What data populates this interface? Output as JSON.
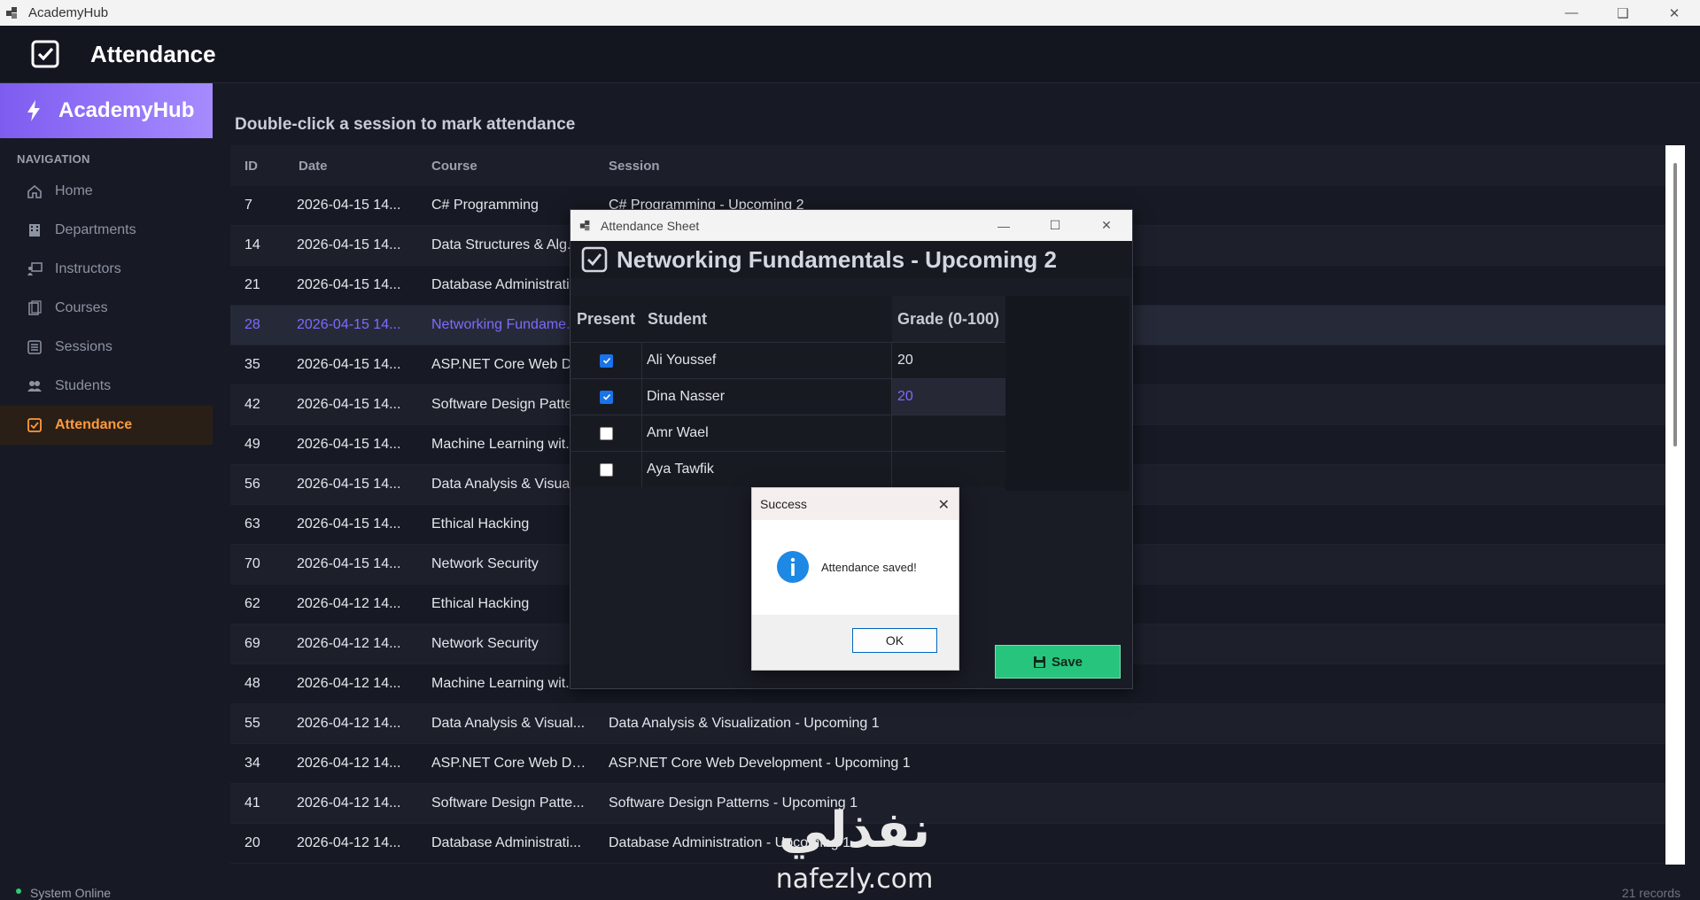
{
  "window": {
    "title": "AcademyHub"
  },
  "header": {
    "title": "Attendance"
  },
  "sidebar": {
    "brand": "AcademyHub",
    "nav_label": "NAVIGATION",
    "items": [
      {
        "label": "Home",
        "icon": "home-icon"
      },
      {
        "label": "Departments",
        "icon": "building-icon"
      },
      {
        "label": "Instructors",
        "icon": "person-board-icon"
      },
      {
        "label": "Courses",
        "icon": "book-icon"
      },
      {
        "label": "Sessions",
        "icon": "list-icon"
      },
      {
        "label": "Students",
        "icon": "users-icon"
      },
      {
        "label": "Attendance",
        "icon": "checkbox-icon",
        "active": true
      }
    ]
  },
  "main": {
    "instruction": "Double-click a session to mark attendance",
    "columns": {
      "id": "ID",
      "date": "Date",
      "course": "Course",
      "session": "Session"
    },
    "rows": [
      {
        "id": "7",
        "date": "2026-04-15 14...",
        "course": "C# Programming",
        "session": "C# Programming - Upcoming 2"
      },
      {
        "id": "14",
        "date": "2026-04-15 14...",
        "course": "Data Structures & Alg...",
        "session": ""
      },
      {
        "id": "21",
        "date": "2026-04-15 14...",
        "course": "Database Administrati...",
        "session": ""
      },
      {
        "id": "28",
        "date": "2026-04-15 14...",
        "course": "Networking Fundame...",
        "session": ""
      },
      {
        "id": "35",
        "date": "2026-04-15 14...",
        "course": "ASP.NET Core Web De...",
        "session": ""
      },
      {
        "id": "42",
        "date": "2026-04-15 14...",
        "course": "Software Design Patte...",
        "session": ""
      },
      {
        "id": "49",
        "date": "2026-04-15 14...",
        "course": "Machine Learning wit...",
        "session": ""
      },
      {
        "id": "56",
        "date": "2026-04-15 14...",
        "course": "Data Analysis & Visual...",
        "session": ""
      },
      {
        "id": "63",
        "date": "2026-04-15 14...",
        "course": "Ethical Hacking",
        "session": ""
      },
      {
        "id": "70",
        "date": "2026-04-15 14...",
        "course": "Network Security",
        "session": ""
      },
      {
        "id": "62",
        "date": "2026-04-12 14...",
        "course": "Ethical Hacking",
        "session": ""
      },
      {
        "id": "69",
        "date": "2026-04-12 14...",
        "course": "Network Security",
        "session": ""
      },
      {
        "id": "48",
        "date": "2026-04-12 14...",
        "course": "Machine Learning wit...",
        "session": ""
      },
      {
        "id": "55",
        "date": "2026-04-12 14...",
        "course": "Data Analysis & Visual...",
        "session": "Data Analysis & Visualization - Upcoming 1"
      },
      {
        "id": "34",
        "date": "2026-04-12 14...",
        "course": "ASP.NET Core Web De...",
        "session": "ASP.NET Core Web Development - Upcoming 1"
      },
      {
        "id": "41",
        "date": "2026-04-12 14...",
        "course": "Software Design Patte...",
        "session": "Software Design Patterns - Upcoming 1"
      },
      {
        "id": "20",
        "date": "2026-04-12 14...",
        "course": "Database Administrati...",
        "session": "Database Administration - Upcoming 1"
      }
    ],
    "selected_row_id": "28"
  },
  "status": {
    "online": "System Online",
    "records": "21 records"
  },
  "sheet": {
    "window_title": "Attendance Sheet",
    "title": "Networking Fundamentals - Upcoming 2",
    "columns": {
      "present": "Present",
      "student": "Student",
      "grade": "Grade (0-100)"
    },
    "students": [
      {
        "present": true,
        "name": "Ali Youssef",
        "grade": "20"
      },
      {
        "present": true,
        "name": "Dina Nasser",
        "grade": "20"
      },
      {
        "present": false,
        "name": "Amr Wael",
        "grade": ""
      },
      {
        "present": false,
        "name": "Aya Tawfik",
        "grade": ""
      }
    ],
    "save_label": "Save"
  },
  "message_box": {
    "title": "Success",
    "text": "Attendance saved!",
    "ok_label": "OK"
  },
  "watermark": {
    "arabic": "نفذلي",
    "latin": "nafezly.com"
  },
  "colors": {
    "accent_purple": "#7e5cf0",
    "accent_orange": "#ff9a3c",
    "save_green": "#27c47e"
  }
}
